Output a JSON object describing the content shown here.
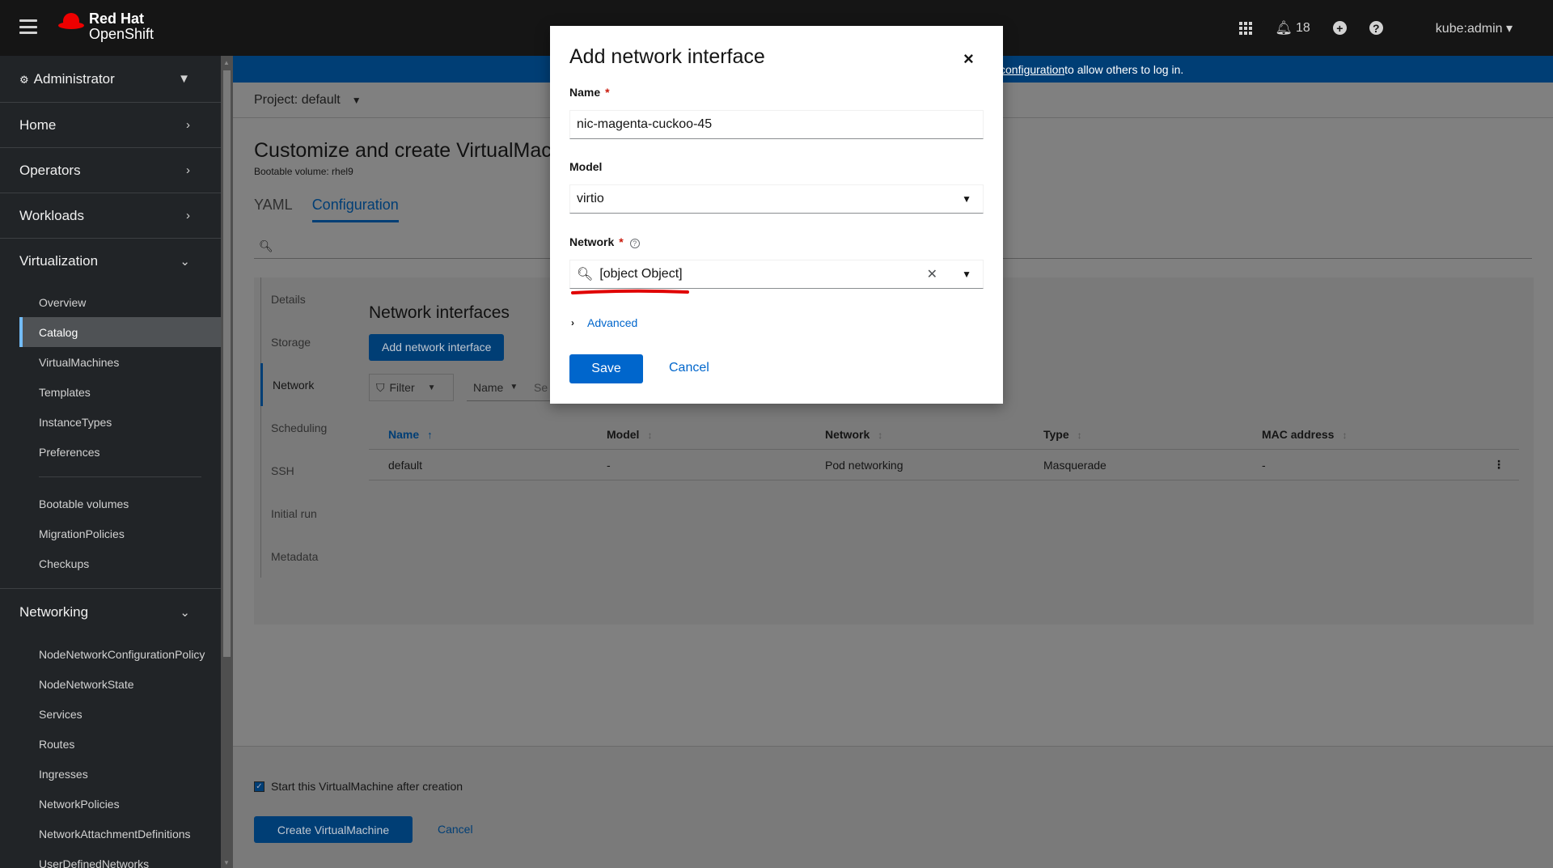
{
  "masthead": {
    "brand_line1": "Red Hat",
    "brand_line2": "OpenShift",
    "notifications_count": "18",
    "user": "kube:admin"
  },
  "sidebar": {
    "perspective": "Administrator",
    "sections": {
      "home": "Home",
      "operators": "Operators",
      "workloads": "Workloads",
      "virtualization": "Virtualization",
      "networking": "Networking"
    },
    "virtualization_items": [
      "Overview",
      "Catalog",
      "VirtualMachines",
      "Templates",
      "InstanceTypes",
      "Preferences"
    ],
    "virtualization_items2": [
      "Bootable volumes",
      "MigrationPolicies",
      "Checkups"
    ],
    "networking_items": [
      "NodeNetworkConfigurationPolicy",
      "NodeNetworkState",
      "Services",
      "Routes",
      "Ingresses",
      "NetworkPolicies",
      "NetworkAttachmentDefinitions",
      "UserDefinedNetworks"
    ]
  },
  "info_bar": {
    "link": "configuration",
    "text": " to allow others to log in."
  },
  "project": "Project: default",
  "page": {
    "title": "Customize and create VirtualMachine",
    "subtitle": "Bootable volume: rhel9",
    "tabs": [
      "YAML",
      "Configuration"
    ]
  },
  "vtabs": [
    "Details",
    "Storage",
    "Network",
    "Scheduling",
    "SSH",
    "Initial run",
    "Metadata"
  ],
  "network_interfaces": {
    "title": "Network interfaces",
    "add_button": "Add network interface",
    "filter_label": "Filter",
    "name_filter": "Name",
    "search_placeholder": "Se",
    "columns": [
      "Name",
      "Model",
      "Network",
      "Type",
      "MAC address"
    ],
    "rows": [
      {
        "name": "default",
        "model": "-",
        "network": "Pod networking",
        "type": "Masquerade",
        "mac": "-"
      }
    ]
  },
  "footer": {
    "start_label": "Start this VirtualMachine after creation",
    "create_button": "Create VirtualMachine",
    "cancel": "Cancel"
  },
  "modal": {
    "title": "Add network interface",
    "name_label": "Name",
    "name_value": "nic-magenta-cuckoo-45",
    "model_label": "Model",
    "model_value": "virtio",
    "network_label": "Network",
    "network_value": "[object Object]",
    "advanced": "Advanced",
    "save": "Save",
    "cancel": "Cancel",
    "annotation_color": "#e00000"
  }
}
